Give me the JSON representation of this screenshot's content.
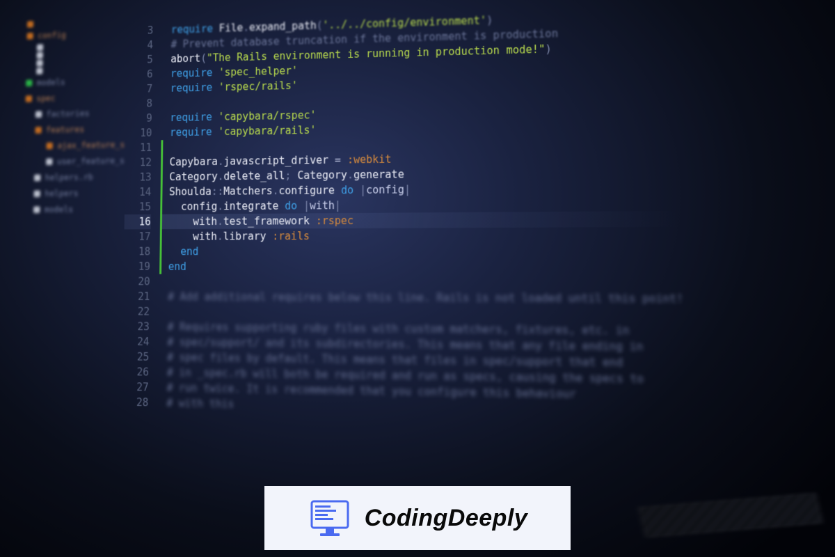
{
  "sidebar": {
    "items": [
      {
        "icon": "orange",
        "indent": 0,
        "label": ""
      },
      {
        "icon": "orange",
        "indent": 0,
        "label": "config"
      },
      {
        "icon": "white",
        "indent": 1,
        "label": ""
      },
      {
        "icon": "white",
        "indent": 1,
        "label": ""
      },
      {
        "icon": "white",
        "indent": 1,
        "label": ""
      },
      {
        "icon": "white",
        "indent": 1,
        "label": ""
      },
      {
        "icon": "green",
        "indent": 0,
        "label": "models"
      },
      {
        "icon": "orange",
        "indent": 0,
        "label": "spec"
      },
      {
        "icon": "white",
        "indent": 1,
        "label": "factories"
      },
      {
        "icon": "orange",
        "indent": 1,
        "label": "features"
      },
      {
        "icon": "orange",
        "indent": 2,
        "label": "ajax_feature_spec"
      },
      {
        "icon": "white",
        "indent": 2,
        "label": "user_feature_spec"
      },
      {
        "icon": "white",
        "indent": 1,
        "label": "helpers.rb"
      },
      {
        "icon": "white",
        "indent": 1,
        "label": "helpers"
      },
      {
        "icon": "white",
        "indent": 1,
        "label": "models"
      }
    ]
  },
  "editor": {
    "first_line_no": 3,
    "active_line_no": 16,
    "change_bar_from": 11,
    "change_bar_to": 19,
    "lines": [
      {
        "n": 3,
        "cls": "farblur",
        "tokens": [
          [
            "tok-kw",
            "require "
          ],
          [
            "tok-const",
            "File"
          ],
          [
            "tok-punct",
            "."
          ],
          [
            "tok-method",
            "expand_path"
          ],
          [
            "tok-punct",
            "("
          ],
          [
            "tok-string",
            "'../../config/environment'"
          ],
          [
            "tok-punct",
            ")"
          ]
        ]
      },
      {
        "n": 4,
        "cls": "farblur",
        "tokens": [
          [
            "tok-comment",
            "# Prevent database truncation if the environment is production"
          ]
        ]
      },
      {
        "n": 5,
        "cls": "midblur",
        "tokens": [
          [
            "tok-method",
            "abort"
          ],
          [
            "tok-punct",
            "("
          ],
          [
            "tok-string",
            "\"The Rails environment is running in production mode!\""
          ],
          [
            "tok-punct",
            ")"
          ]
        ]
      },
      {
        "n": 6,
        "cls": "midblur",
        "tokens": [
          [
            "tok-kw",
            "require "
          ],
          [
            "tok-string",
            "'spec_helper'"
          ]
        ]
      },
      {
        "n": 7,
        "cls": "midblur",
        "tokens": [
          [
            "tok-kw",
            "require "
          ],
          [
            "tok-string",
            "'rspec/rails'"
          ]
        ]
      },
      {
        "n": 8,
        "cls": "",
        "tokens": []
      },
      {
        "n": 9,
        "cls": "",
        "tokens": [
          [
            "tok-kw",
            "require "
          ],
          [
            "tok-string",
            "'capybara/rspec'"
          ]
        ]
      },
      {
        "n": 10,
        "cls": "",
        "tokens": [
          [
            "tok-kw",
            "require "
          ],
          [
            "tok-string",
            "'capybara/rails'"
          ]
        ]
      },
      {
        "n": 11,
        "cls": "",
        "tokens": []
      },
      {
        "n": 12,
        "cls": "",
        "tokens": [
          [
            "tok-const",
            "Capybara"
          ],
          [
            "tok-punct",
            "."
          ],
          [
            "tok-method",
            "javascript_driver"
          ],
          [
            "tok-plain",
            " = "
          ],
          [
            "tok-param",
            ":webkit"
          ]
        ]
      },
      {
        "n": 13,
        "cls": "",
        "tokens": [
          [
            "tok-const",
            "Category"
          ],
          [
            "tok-punct",
            "."
          ],
          [
            "tok-method",
            "delete_all"
          ],
          [
            "tok-punct",
            "; "
          ],
          [
            "tok-const",
            "Category"
          ],
          [
            "tok-punct",
            "."
          ],
          [
            "tok-method",
            "generate"
          ]
        ]
      },
      {
        "n": 14,
        "cls": "",
        "tokens": [
          [
            "tok-const",
            "Shoulda"
          ],
          [
            "tok-punct",
            "::"
          ],
          [
            "tok-const",
            "Matchers"
          ],
          [
            "tok-punct",
            "."
          ],
          [
            "tok-method",
            "configure "
          ],
          [
            "tok-kw",
            "do "
          ],
          [
            "tok-punct",
            "|"
          ],
          [
            "tok-plain",
            "config"
          ],
          [
            "tok-punct",
            "|"
          ]
        ]
      },
      {
        "n": 15,
        "cls": "",
        "tokens": [
          [
            "tok-plain",
            "  "
          ],
          [
            "tok-method",
            "config"
          ],
          [
            "tok-punct",
            "."
          ],
          [
            "tok-method",
            "integrate "
          ],
          [
            "tok-kw",
            "do "
          ],
          [
            "tok-punct",
            "|"
          ],
          [
            "tok-plain",
            "with"
          ],
          [
            "tok-punct",
            "|"
          ]
        ]
      },
      {
        "n": 16,
        "cls": "",
        "tokens": [
          [
            "tok-plain",
            "    "
          ],
          [
            "tok-method",
            "with"
          ],
          [
            "tok-punct",
            "."
          ],
          [
            "tok-method",
            "test_framework "
          ],
          [
            "tok-param",
            ":rspec"
          ]
        ]
      },
      {
        "n": 17,
        "cls": "",
        "tokens": [
          [
            "tok-plain",
            "    "
          ],
          [
            "tok-method",
            "with"
          ],
          [
            "tok-punct",
            "."
          ],
          [
            "tok-method",
            "library "
          ],
          [
            "tok-param",
            ":rails"
          ]
        ]
      },
      {
        "n": 18,
        "cls": "",
        "tokens": [
          [
            "tok-plain",
            "  "
          ],
          [
            "tok-kw",
            "end"
          ]
        ]
      },
      {
        "n": 19,
        "cls": "",
        "tokens": [
          [
            "tok-kw",
            "end"
          ]
        ]
      },
      {
        "n": 20,
        "cls": "heavyblur",
        "tokens": []
      },
      {
        "n": 21,
        "cls": "heavyblur",
        "tokens": [
          [
            "tok-comment",
            "# Add additional requires below this line. Rails is not loaded until this point!"
          ]
        ]
      },
      {
        "n": 22,
        "cls": "heavyblur",
        "tokens": []
      },
      {
        "n": 23,
        "cls": "heavyblur",
        "tokens": [
          [
            "tok-comment",
            "# Requires supporting ruby files with custom matchers, fixtures, etc. in"
          ]
        ]
      },
      {
        "n": 24,
        "cls": "heavyblur",
        "tokens": [
          [
            "tok-comment",
            "# spec/support/ and its subdirectories. This means that any file ending in"
          ]
        ]
      },
      {
        "n": 25,
        "cls": "heavyblur",
        "tokens": [
          [
            "tok-comment",
            "# spec files by default. This means that files in spec/support that end"
          ]
        ]
      },
      {
        "n": 26,
        "cls": "heavyblur",
        "tokens": [
          [
            "tok-comment",
            "# in _spec.rb will both be required and run as specs, causing the specs to"
          ]
        ]
      },
      {
        "n": 27,
        "cls": "heavyblur",
        "tokens": [
          [
            "tok-comment",
            "# run twice. It is recommended that you configure this behaviour"
          ]
        ]
      },
      {
        "n": 28,
        "cls": "heavyblur",
        "tokens": [
          [
            "tok-comment",
            "# with this"
          ]
        ]
      }
    ]
  },
  "brand": {
    "text": "CodingDeeply"
  }
}
